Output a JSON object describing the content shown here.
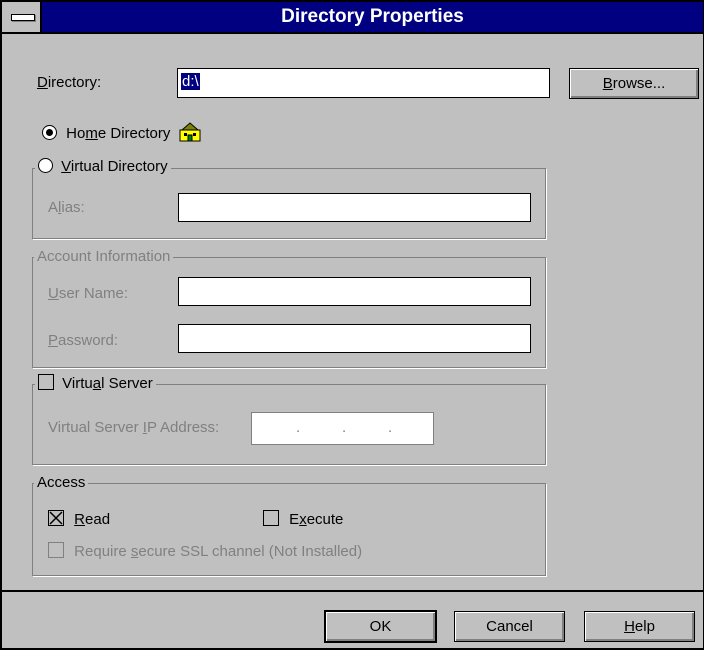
{
  "window": {
    "title": "Directory Properties"
  },
  "directory": {
    "label_pre": "",
    "label_u": "D",
    "label_post": "irectory:",
    "value": "d:\\"
  },
  "browse": {
    "pre": "",
    "u": "B",
    "post": "rowse..."
  },
  "home_directory": {
    "pre": "Ho",
    "u": "m",
    "post": "e Directory",
    "selected": true,
    "icon": "home-folder-icon"
  },
  "virtual_directory": {
    "pre": "",
    "u": "V",
    "post": "irtual Directory",
    "selected": false,
    "alias": {
      "pre": "A",
      "u": "l",
      "post": "ias:",
      "value": ""
    }
  },
  "account": {
    "title": "Account Information",
    "username": {
      "pre": "",
      "u": "U",
      "post": "ser Name:",
      "value": ""
    },
    "password": {
      "pre": "",
      "u": "P",
      "post": "assword:",
      "value": ""
    }
  },
  "virtual_server": {
    "pre": "Virtu",
    "u": "a",
    "post": "l Server",
    "checked": false,
    "ip": {
      "pre": "Virtual Server ",
      "u": "I",
      "post": "P Address:",
      "dots": [
        ".",
        ".",
        "."
      ]
    }
  },
  "access": {
    "title": "Access",
    "read": {
      "pre": "",
      "u": "R",
      "post": "ead",
      "checked": true
    },
    "execute": {
      "pre": "E",
      "u": "x",
      "post": "ecute",
      "checked": false
    },
    "ssl": {
      "pre": "Require ",
      "u": "s",
      "post": "ecure SSL channel (Not Installed)",
      "checked": false
    }
  },
  "buttons": {
    "ok": "OK",
    "cancel": "Cancel",
    "help": {
      "pre": "",
      "u": "H",
      "post": "elp"
    }
  }
}
